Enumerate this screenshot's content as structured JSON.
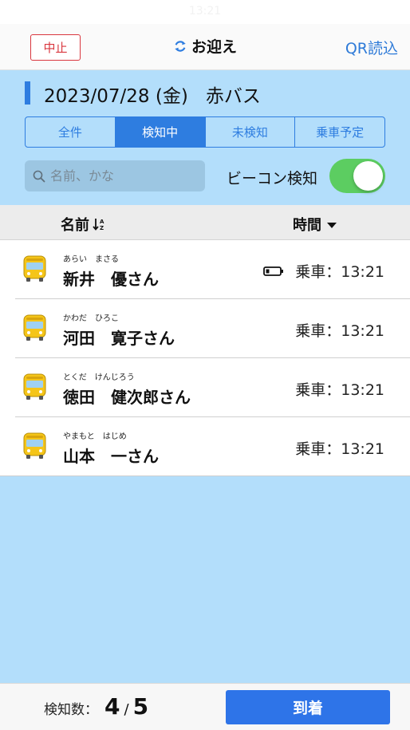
{
  "status_bar": {
    "time": "13:21"
  },
  "nav": {
    "cancel_label": "中止",
    "title": "お迎え",
    "qr_label": "QR読込"
  },
  "header": {
    "date": "2023/07/28 (金)",
    "bus_name": "赤バス"
  },
  "filter_tabs": [
    {
      "label": "全件",
      "selected": false
    },
    {
      "label": "検知中",
      "selected": true
    },
    {
      "label": "未検知",
      "selected": false
    },
    {
      "label": "乗車予定",
      "selected": false
    }
  ],
  "search": {
    "placeholder": "名前、かな",
    "value": ""
  },
  "beacon": {
    "label": "ビーコン検知",
    "enabled": true
  },
  "columns": {
    "name": "名前",
    "time": "時間"
  },
  "riders": [
    {
      "kana": "あらい　まさる",
      "name": "新井　優さん",
      "battery_icon": "battery-low-icon",
      "time": "乗車：13:21"
    },
    {
      "kana": "かわだ　ひろこ",
      "name": "河田　寛子さん",
      "time": "乗車：13:21"
    },
    {
      "kana": "とくだ　けんじろう",
      "name": "徳田　健次郎さん",
      "time": "乗車：13:21"
    },
    {
      "kana": "やまもと　はじめ",
      "name": "山本　一さん",
      "time": "乗車：13:21"
    }
  ],
  "footer": {
    "count_label": "検知数：",
    "detected": "4",
    "slash": "/",
    "total": "5",
    "arrive_label": "到着"
  },
  "colors": {
    "accent": "#2e7de0",
    "panel": "#b3defb",
    "cancel": "#d9363e",
    "toggle_on": "#5ccd61"
  }
}
